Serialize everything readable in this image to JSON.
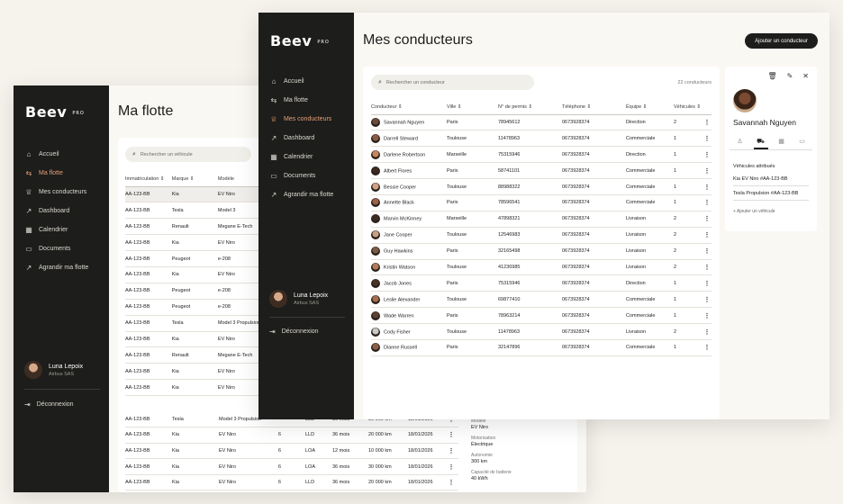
{
  "brand": {
    "name": "Beev",
    "suffix": "PRO"
  },
  "nav": [
    {
      "label": "Accueil",
      "icon": "home-icon"
    },
    {
      "label": "Ma flotte",
      "icon": "car-icon"
    },
    {
      "label": "Mes conducteurs",
      "icon": "driver-icon"
    },
    {
      "label": "Dashboard",
      "icon": "chart-icon"
    },
    {
      "label": "Calendrier",
      "icon": "calendar-icon"
    },
    {
      "label": "Documents",
      "icon": "documents-icon"
    },
    {
      "label": "Agrandir ma flotte",
      "icon": "grow-icon"
    }
  ],
  "user": {
    "name": "Luna Lepoix",
    "company": "Airbus SAS"
  },
  "logout": "Déconnexion",
  "fleet": {
    "title": "Ma flotte",
    "search_placeholder": "Rechercher un véhicule",
    "headers": [
      "Immatriculation",
      "Marque",
      "Modèle"
    ],
    "rows": [
      [
        "AA-123-BB",
        "Kia",
        "EV Niro"
      ],
      [
        "AA-123-BB",
        "Tesla",
        "Model 3"
      ],
      [
        "AA-123-BB",
        "Renault",
        "Megane E-Tech"
      ],
      [
        "AA-123-BB",
        "Kia",
        "EV Niro"
      ],
      [
        "AA-123-BB",
        "Peugeot",
        "e-208"
      ],
      [
        "AA-123-BB",
        "Kia",
        "EV Niro"
      ],
      [
        "AA-123-BB",
        "Peugeot",
        "e-208"
      ],
      [
        "AA-123-BB",
        "Peugeot",
        "e-208"
      ],
      [
        "AA-123-BB",
        "Tesla",
        "Model 3 Propulsion"
      ],
      [
        "AA-123-BB",
        "Kia",
        "EV Niro"
      ],
      [
        "AA-123-BB",
        "Renault",
        "Megane E-Tech"
      ],
      [
        "AA-123-BB",
        "Kia",
        "EV Niro"
      ],
      [
        "AA-123-BB",
        "Kia",
        "EV Niro"
      ]
    ],
    "rows_full": [
      [
        "AA-123-BB",
        "Tesla",
        "Model 3 Propulsion",
        "",
        "LLD",
        "36 mois",
        "30 000 km",
        "18/01/2026"
      ],
      [
        "AA-123-BB",
        "Kia",
        "EV Niro",
        "6",
        "LLD",
        "36 mois",
        "20 000 km",
        "18/01/2026"
      ],
      [
        "AA-123-BB",
        "Kia",
        "EV Niro",
        "6",
        "LOA",
        "12 mois",
        "10 000 km",
        "18/01/2026"
      ],
      [
        "AA-123-BB",
        "Kia",
        "EV Niro",
        "6",
        "LOA",
        "36 mois",
        "30 000 km",
        "18/01/2026"
      ],
      [
        "AA-123-BB",
        "Kia",
        "EV Niro",
        "6",
        "LLD",
        "36 mois",
        "20 000 km",
        "18/01/2026"
      ]
    ],
    "side_detail": [
      {
        "label": "Modèle",
        "value": "EV Niro"
      },
      {
        "label": "Motorisation",
        "value": "Électrique"
      },
      {
        "label": "Autonomie",
        "value": "300 km"
      },
      {
        "label": "Capacité de batterie",
        "value": "40 kWh"
      }
    ]
  },
  "drivers": {
    "title": "Mes conducteurs",
    "add_button": "Ajouter un conducteur",
    "search_placeholder": "Rechercher un conducteur",
    "count": "22 conducteurs",
    "headers": [
      "Conducteur",
      "Ville",
      "N° de permis",
      "Téléphone",
      "Équipe",
      "Véhicules"
    ],
    "rows": [
      [
        "Savannah Nguyen",
        "Paris",
        "78945612",
        "0673928374",
        "Direction",
        "2"
      ],
      [
        "Darrell Steward",
        "Toulouse",
        "11478963",
        "0673928374",
        "Commerciale",
        "1"
      ],
      [
        "Darlene Robertson",
        "Marseille",
        "75315946",
        "0673928374",
        "Direction",
        "1"
      ],
      [
        "Albert Flores",
        "Paris",
        "58741101",
        "0673928374",
        "Commerciale",
        "1"
      ],
      [
        "Bessie Cooper",
        "Toulouse",
        "88988322",
        "0673928374",
        "Commerciale",
        "1"
      ],
      [
        "Annette Black",
        "Paris",
        "78596541",
        "0673928374",
        "Commerciale",
        "1"
      ],
      [
        "Marvin McKinney",
        "Marseille",
        "47898321",
        "0673928374",
        "Livraison",
        "2"
      ],
      [
        "Jane Cooper",
        "Toulouse",
        "12546983",
        "0673928374",
        "Livraison",
        "2"
      ],
      [
        "Guy Hawkins",
        "Paris",
        "32165498",
        "0673928374",
        "Livraison",
        "2"
      ],
      [
        "Kristin Watson",
        "Toulouse",
        "41236985",
        "0673928374",
        "Livraison",
        "2"
      ],
      [
        "Jacob Jones",
        "Paris",
        "75315946",
        "0673928374",
        "Direction",
        "1"
      ],
      [
        "Leslie Alexander",
        "Toulouse",
        "69877410",
        "0673928374",
        "Commerciale",
        "1"
      ],
      [
        "Wade Warren",
        "Paris",
        "78963214",
        "0673928374",
        "Commerciale",
        "1"
      ],
      [
        "Cody Fisher",
        "Toulouse",
        "11478963",
        "0673928374",
        "Livraison",
        "2"
      ],
      [
        "Dianne Russell",
        "Paris",
        "32147896",
        "0673928374",
        "Commerciale",
        "1"
      ]
    ],
    "detail": {
      "name": "Savannah Nguyen",
      "section": "Véhicules attribués",
      "vehicles": [
        "Kia EV Niro #AA-123-BB",
        "Tesla Propulsion #AA-123-BB"
      ],
      "add": "+ Ajouter un véhicule"
    }
  },
  "colors": {
    "sidebar": "#1d1d1b",
    "accent": "#e6a07a",
    "background": "#f6f3ec"
  }
}
